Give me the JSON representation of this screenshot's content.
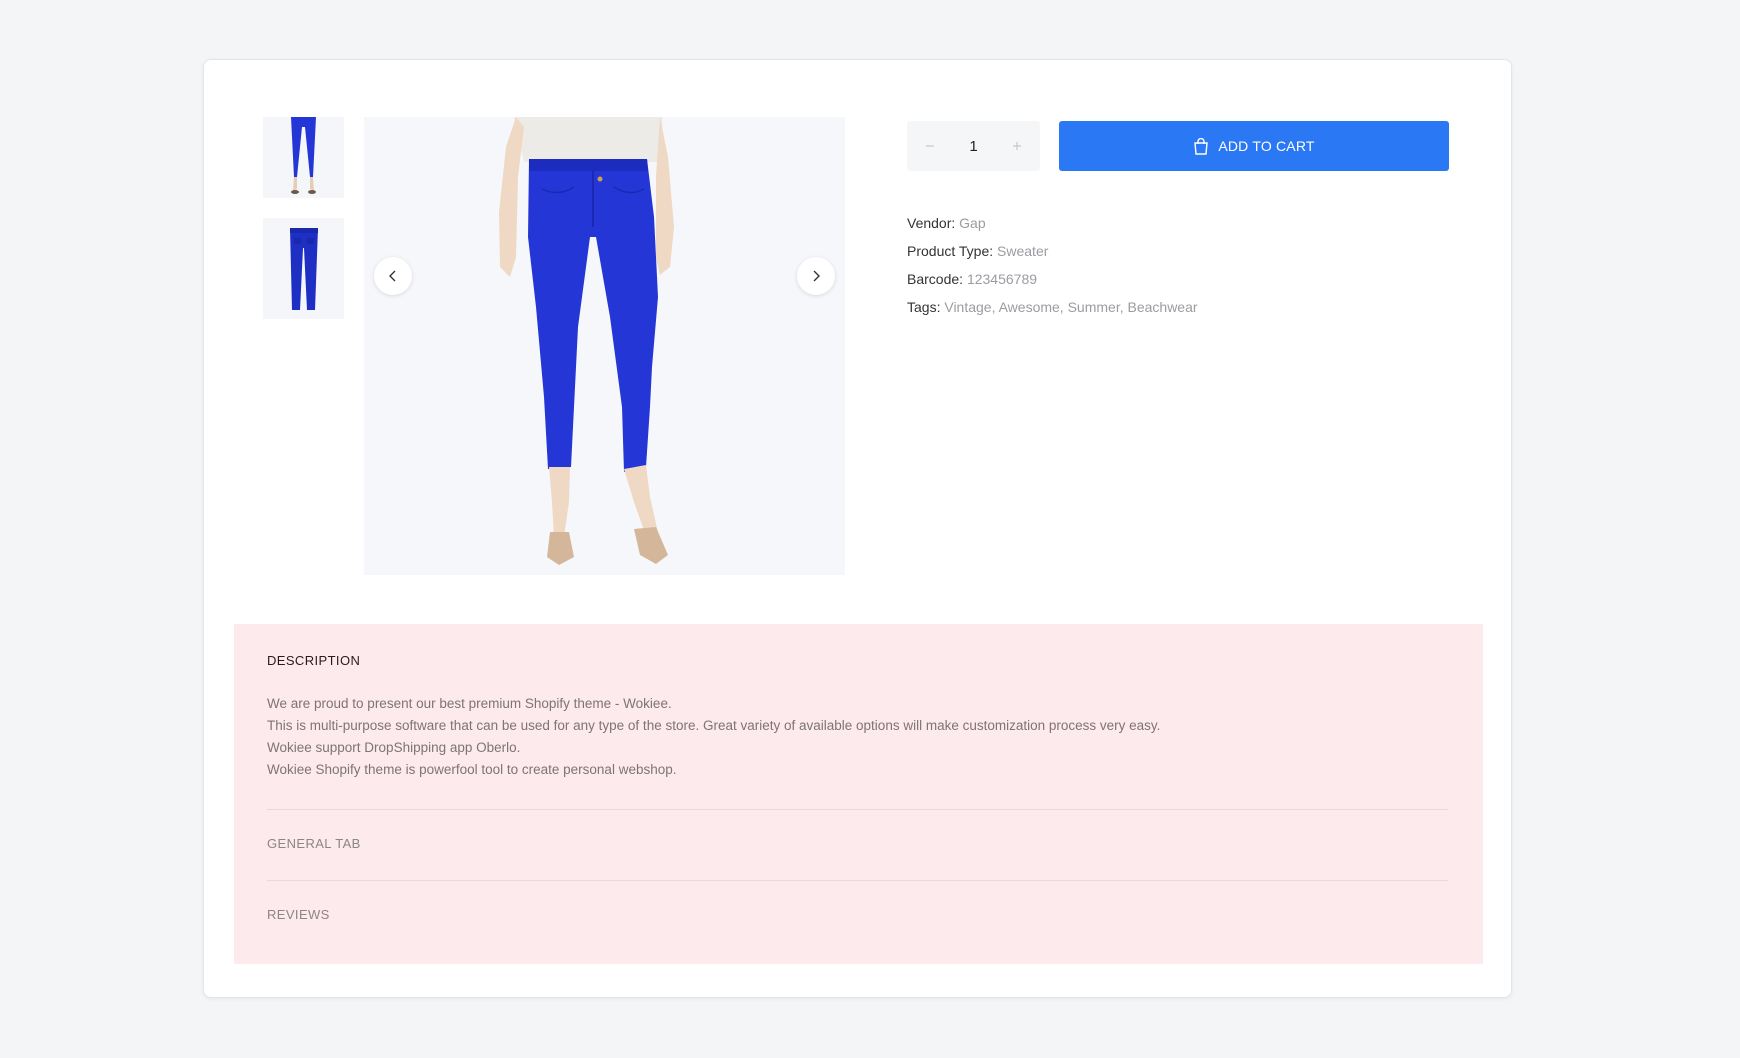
{
  "product": {
    "quantity": "1",
    "add_to_cart_label": "ADD TO CART",
    "meta": [
      {
        "label": "Vendor:",
        "value": "Gap"
      },
      {
        "label": "Product Type:",
        "value": "Sweater"
      },
      {
        "label": "Barcode:",
        "value": "123456789"
      },
      {
        "label": "Tags:",
        "value": "Vintage, Awesome, Summer, Beachwear"
      }
    ],
    "image_color": "#2536d6"
  },
  "tabs": {
    "description": {
      "title": "DESCRIPTION",
      "lines": [
        "We are proud to present our best premium Shopify theme - Wokiee.",
        "This is multi-purpose software that can be used for any type of the store. Great variety of available options will make customization process very easy.",
        "Wokiee support DropShipping app Oberlo.",
        "Wokiee Shopify theme is powerfool tool to create personal webshop."
      ]
    },
    "general": {
      "title": "GENERAL TAB"
    },
    "reviews": {
      "title": "REVIEWS"
    }
  },
  "icons": {
    "prev": "chevron-left-icon",
    "next": "chevron-right-icon",
    "cart": "shopping-bag-icon",
    "minus": "minus-icon",
    "plus": "plus-icon"
  },
  "colors": {
    "accent": "#2b78f5",
    "accordion_bg": "#fdeaec",
    "page_bg": "#f4f5f7"
  }
}
